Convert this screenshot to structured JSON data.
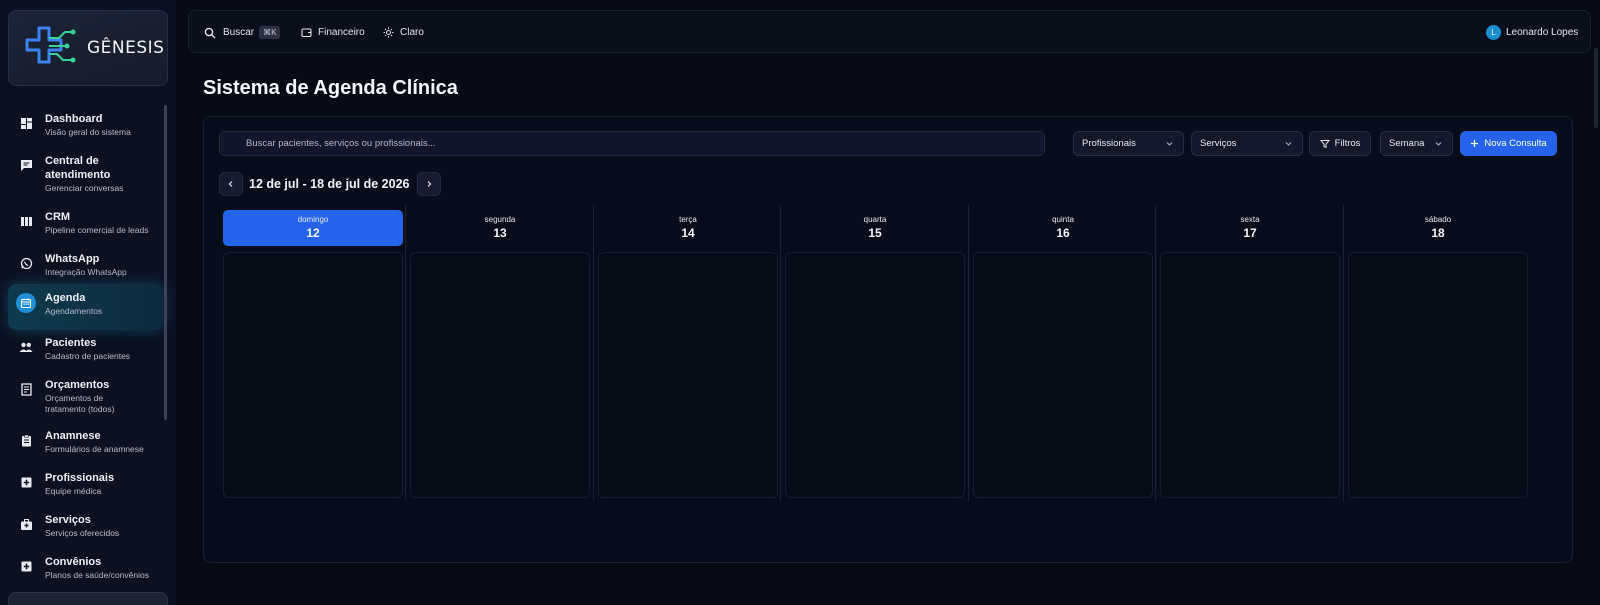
{
  "brand": {
    "name": "GÊNESIS"
  },
  "sidebar": {
    "items": [
      {
        "label": "Dashboard",
        "sub": "Visão geral do sistema",
        "icon": "dashboard-icon",
        "active": false
      },
      {
        "label": "Central de atendimento",
        "sub": "Gerenciar conversas",
        "icon": "chat-icon",
        "active": false
      },
      {
        "label": "CRM",
        "sub": "Pipeline comercial de leads",
        "icon": "columns-icon",
        "active": false
      },
      {
        "label": "WhatsApp",
        "sub": "Integração WhatsApp",
        "icon": "whatsapp-icon",
        "active": false
      },
      {
        "label": "Agenda",
        "sub": "Agendamentos",
        "icon": "calendar-icon",
        "active": true
      },
      {
        "label": "Pacientes",
        "sub": "Cadastro de pacientes",
        "icon": "people-icon",
        "active": false
      },
      {
        "label": "Orçamentos",
        "sub": "Orçamentos de tratamento (todos)",
        "icon": "receipt-icon",
        "active": false
      },
      {
        "label": "Anamnese",
        "sub": "Formulários de anamnese",
        "icon": "clipboard-icon",
        "active": false
      },
      {
        "label": "Profissionais",
        "sub": "Equipe médica",
        "icon": "medical-plus-icon",
        "active": false
      },
      {
        "label": "Serviços",
        "sub": "Serviços oferecidos",
        "icon": "medkit-icon",
        "active": false
      },
      {
        "label": "Convênios",
        "sub": "Planos de saúde/convênios",
        "icon": "medical-plus-icon",
        "active": false
      }
    ]
  },
  "topbar": {
    "search_label": "Buscar",
    "search_shortcut": "⌘K",
    "financeiro_label": "Financeiro",
    "theme_label": "Claro",
    "user_initial": "L",
    "user_name": "Leonardo Lopes"
  },
  "page": {
    "title": "Sistema de Agenda Clínica"
  },
  "toolbar": {
    "search_placeholder": "Buscar pacientes, serviços ou profissionais...",
    "professionals_select": "Profissionais",
    "services_select": "Serviços",
    "filters_label": "Filtros",
    "view_select": "Semana",
    "new_appointment_label": "Nova Consulta"
  },
  "calendar": {
    "range_label": "12 de jul - 18 de jul de 2026",
    "days": [
      {
        "name": "domingo",
        "num": "12",
        "today": true
      },
      {
        "name": "segunda",
        "num": "13",
        "today": false
      },
      {
        "name": "terça",
        "num": "14",
        "today": false
      },
      {
        "name": "quarta",
        "num": "15",
        "today": false
      },
      {
        "name": "quinta",
        "num": "16",
        "today": false
      },
      {
        "name": "sexta",
        "num": "17",
        "today": false
      },
      {
        "name": "sábado",
        "num": "18",
        "today": false
      }
    ]
  },
  "colors": {
    "accent": "#2563eb",
    "active_nav": "#0f3a4d",
    "background": "#070b16"
  }
}
